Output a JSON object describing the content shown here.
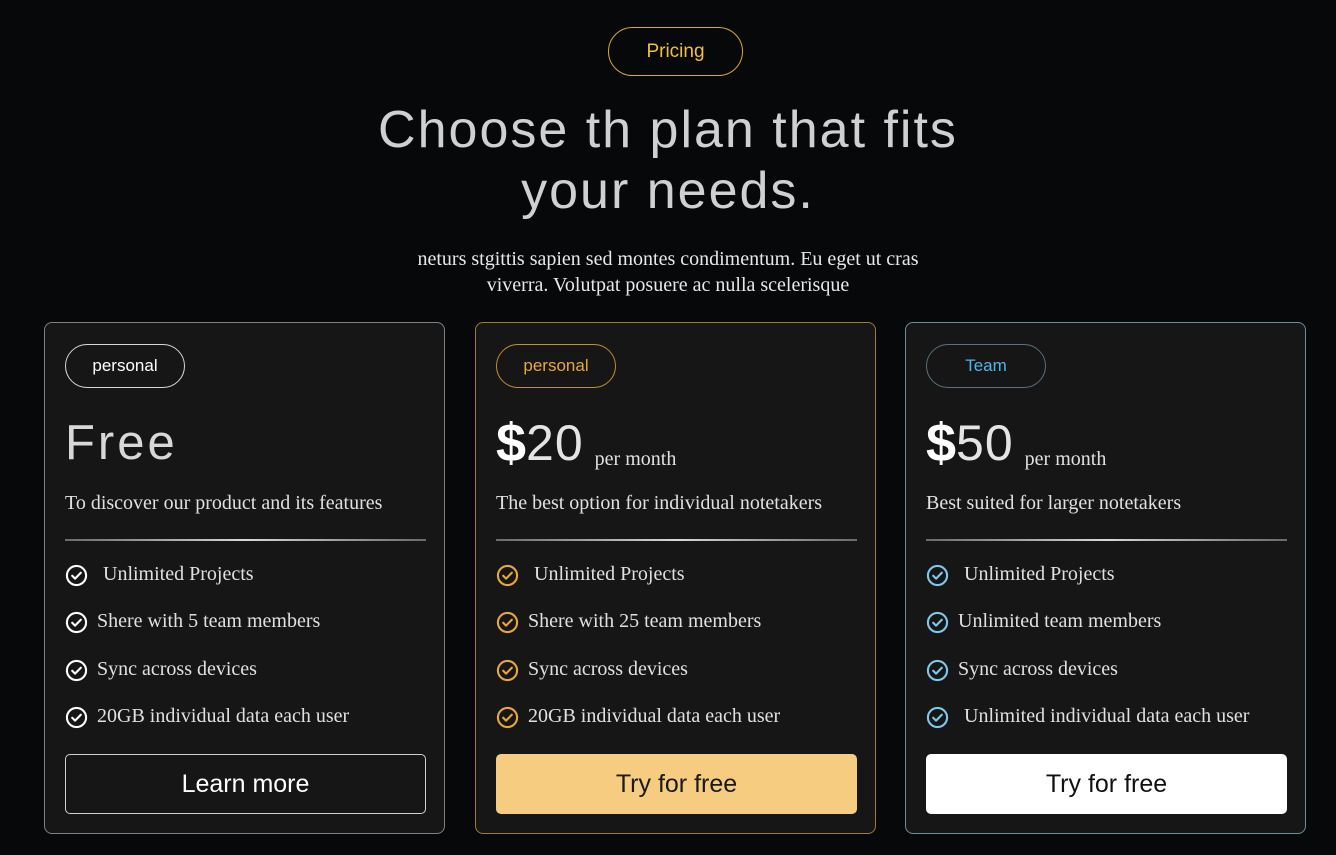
{
  "header": {
    "pill": "Pricing",
    "headline_line1": "Choose th plan that fits",
    "headline_line2": "your needs.",
    "subtitle_line1": "neturs stgittis sapien sed montes condimentum. Eu eget ut cras",
    "subtitle_line2": "viverra. Volutpat posuere ac nulla scelerisque"
  },
  "colors": {
    "background": "#07080a",
    "card": "#161616",
    "accent_gold": "#f5cc80",
    "accent_blue": "#4fb6e6"
  },
  "plans": [
    {
      "badge": "personal",
      "price_text": "Free",
      "description": "To discover our product and its features",
      "check_color": "#ffffff",
      "features": [
        "Unlimited Projects",
        "Shere with 5 team members",
        "Sync across devices",
        "20GB individual data each user"
      ],
      "cta": "Learn more"
    },
    {
      "badge": "personal",
      "currency": "$",
      "amount": "20",
      "period": "per month",
      "description": "The best option for individual notetakers",
      "check_color": "#e6a73b",
      "features": [
        "Unlimited Projects",
        "Shere with 25 team members",
        "Sync across devices",
        "20GB individual data each user"
      ],
      "cta": "Try for free"
    },
    {
      "badge": "Team",
      "currency": "$",
      "amount": "50",
      "period": "per month",
      "description": "Best suited for larger notetakers",
      "check_color": "#7ec8ea",
      "features": [
        "Unlimited Projects",
        "Unlimited team members",
        "Sync across devices",
        "Unlimited individual data each user"
      ],
      "cta": "Try for free"
    }
  ]
}
